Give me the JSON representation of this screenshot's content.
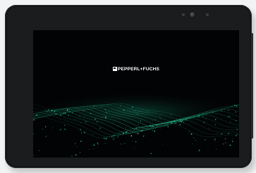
{
  "device": {
    "type": "tablet"
  },
  "screen": {
    "brand_text": "PEPPERL+FUCHS",
    "background_color": "#020304",
    "accent_color": "#2fd6a2",
    "graphic": "green-particle-wave-icon"
  }
}
